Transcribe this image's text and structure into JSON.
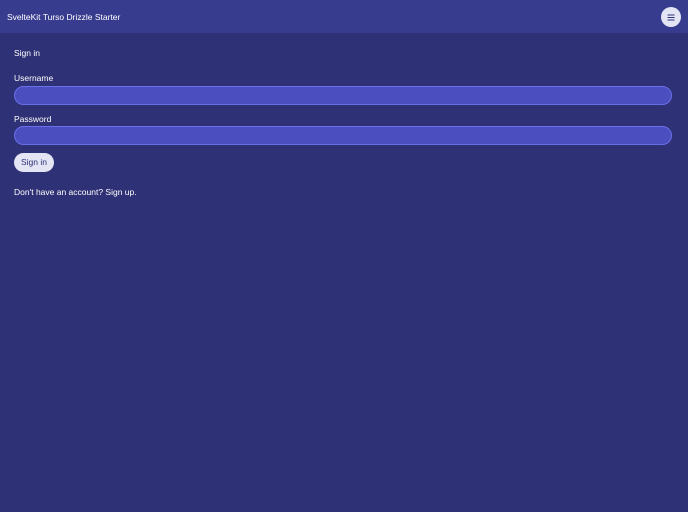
{
  "header": {
    "title": "SvelteKit Turso Drizzle Starter",
    "menu_icon": "menu-icon"
  },
  "form": {
    "title": "Sign in",
    "username": {
      "label": "Username",
      "value": "",
      "placeholder": ""
    },
    "password": {
      "label": "Password",
      "value": "",
      "placeholder": ""
    },
    "submit_label": "Sign in"
  },
  "signup": {
    "prompt": "Don't have an account?",
    "link_label": "Sign up."
  },
  "colors": {
    "background": "#2e3175",
    "header": "#383c8f",
    "input_fill": "#4a4ebf",
    "input_border": "#6a6ee8",
    "button_fill": "#e3e5f4"
  }
}
